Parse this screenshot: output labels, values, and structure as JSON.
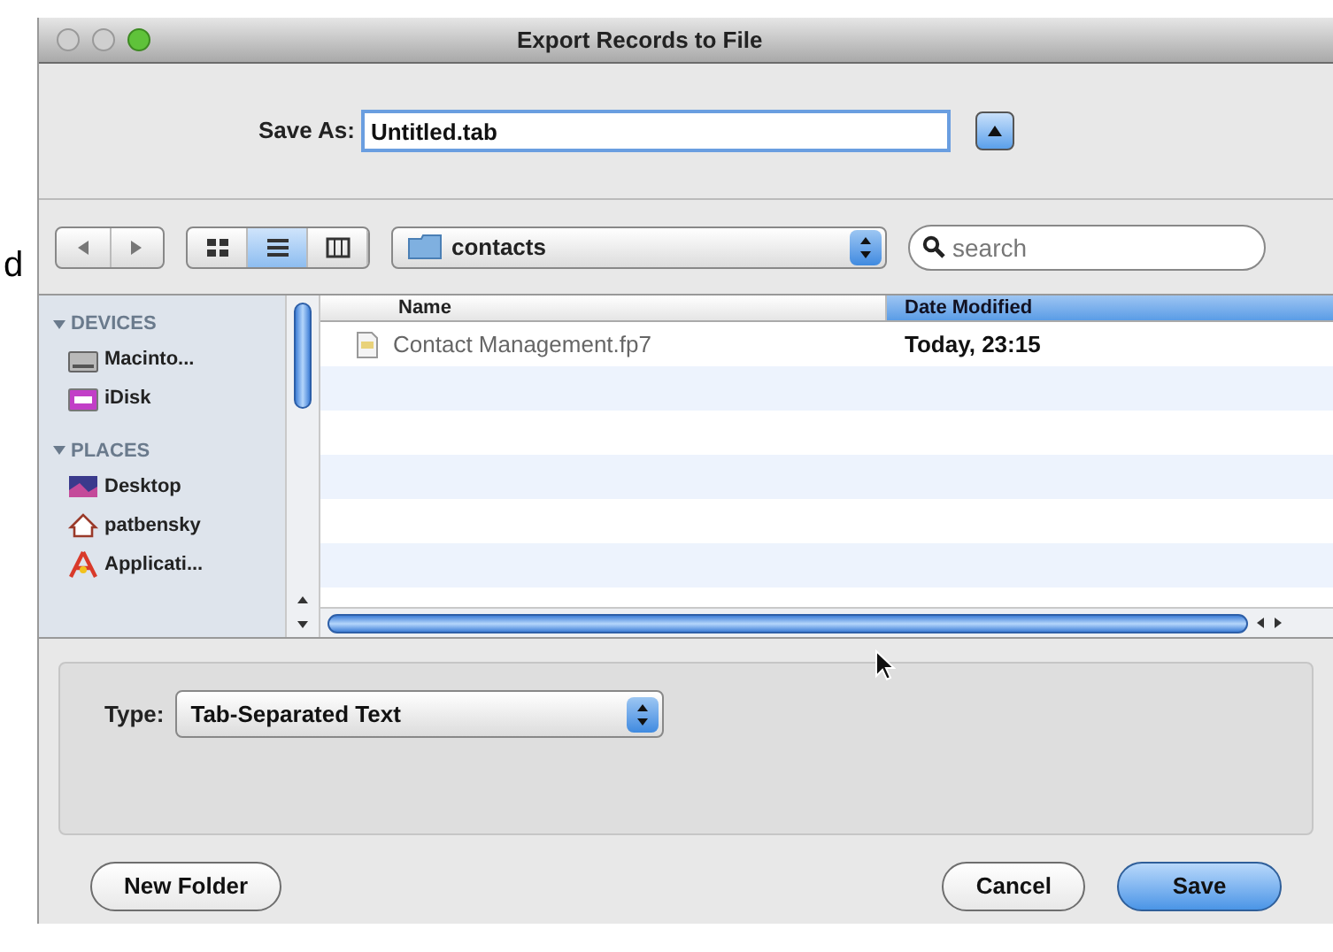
{
  "background_text": "d",
  "window": {
    "title": "Export Records to File"
  },
  "save_as": {
    "label": "Save As:",
    "value": "Untitled.tab"
  },
  "toolbar": {
    "view_modes": [
      {
        "kind": "icon",
        "selected": false
      },
      {
        "kind": "list",
        "selected": true
      },
      {
        "kind": "columns",
        "selected": false
      }
    ],
    "location": "contacts",
    "search": {
      "placeholder": "search"
    }
  },
  "sidebar": {
    "sections": [
      {
        "title": "DEVICES",
        "expanded": true,
        "items": [
          {
            "label": "Macinto...",
            "kind": "disk"
          },
          {
            "label": "iDisk",
            "kind": "idisk"
          }
        ]
      },
      {
        "title": "PLACES",
        "expanded": true,
        "items": [
          {
            "label": "Desktop",
            "kind": "desktop"
          },
          {
            "label": "patbensky",
            "kind": "home"
          },
          {
            "label": "Applicati...",
            "kind": "apps"
          }
        ]
      }
    ]
  },
  "table": {
    "columns": [
      {
        "label": "Name",
        "selected": false
      },
      {
        "label": "Date Modified",
        "selected": true
      }
    ],
    "rows": [
      {
        "name": "Contact Management.fp7",
        "date": "Today, 23:15"
      }
    ]
  },
  "type": {
    "label": "Type:",
    "value": "Tab-Separated Text"
  },
  "buttons": [
    {
      "label": "New Folder",
      "kind": "secondary"
    },
    {
      "label": "Cancel",
      "kind": "secondary"
    },
    {
      "label": "Save",
      "kind": "default"
    }
  ]
}
